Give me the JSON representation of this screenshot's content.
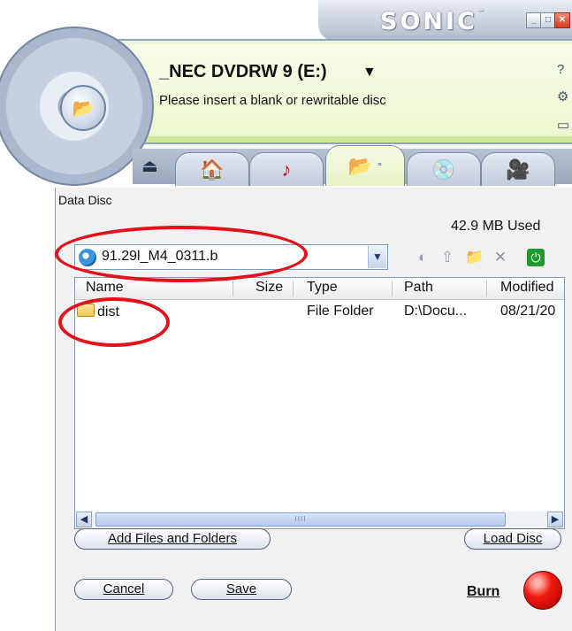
{
  "window": {
    "brand": "SONIC",
    "brand_mark": "™",
    "controls": [
      "_",
      "□",
      "✕"
    ],
    "close_color": "#d53a22"
  },
  "header": {
    "drive_name": "_NEC DVDRW 9 (E:)",
    "drive_arrow": "▼",
    "status": "Please insert a blank or rewritable disc",
    "side_icons": [
      "help-icon",
      "settings-icon",
      "folder-icon"
    ],
    "eject_icon": "⏏"
  },
  "tabs": [
    {
      "icon": "home-icon",
      "glyph": "🏠"
    },
    {
      "icon": "music-icon",
      "glyph": "♪"
    },
    {
      "icon": "data-folder-icon",
      "glyph": "📂",
      "active": true,
      "indicator": "°"
    },
    {
      "icon": "disc-copy-icon",
      "glyph": "💿"
    },
    {
      "icon": "video-camera-icon",
      "glyph": "🎥"
    }
  ],
  "panel": {
    "title": "Data Disc",
    "used": "42.9 MB Used",
    "path_value": "91.29l_M4_0311.b",
    "toolbar_icons": [
      "back-icon",
      "up-icon",
      "new-folder-icon",
      "delete-icon",
      "power-icon"
    ],
    "columns": [
      "Name",
      "Size",
      "Type",
      "Path",
      "Modified"
    ],
    "rows": [
      {
        "name": "dist",
        "size": "",
        "type": "File Folder",
        "path": "D:\\Docu...",
        "modified": "08/21/20"
      }
    ],
    "scroll_grip": "IIII"
  },
  "buttons": {
    "add": "Add Files and Folders",
    "load": "Load Disc",
    "cancel": "Cancel",
    "save": "Save",
    "burn": "Burn"
  },
  "colors": {
    "annotation": "#e4101a",
    "accent_green": "#dff0b8",
    "burn_red": "#f21a0e"
  }
}
